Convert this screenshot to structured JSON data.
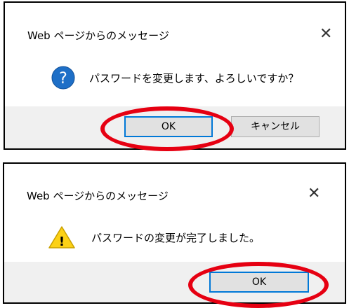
{
  "dialogs": [
    {
      "title": "Web ページからのメッセージ",
      "icon": "question-icon",
      "message": "パスワードを変更します、よろしいですか？",
      "ok_label": "OK",
      "cancel_label": "キャンセル",
      "close_glyph": "✕"
    },
    {
      "title": "Web ページからのメッセージ",
      "icon": "warning-icon",
      "message": "パスワードの変更が完了しました。",
      "ok_label": "OK",
      "close_glyph": "✕"
    }
  ],
  "colors": {
    "highlight": "#e60012",
    "accent_blue": "#0078d7",
    "question_icon": "#1e6fc7",
    "warning_icon": "#fcd116",
    "footer_bg": "#f0f0f0"
  }
}
